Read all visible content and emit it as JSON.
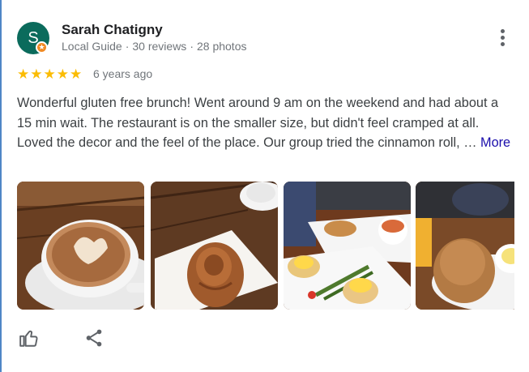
{
  "reviewer": {
    "initial": "S",
    "name": "Sarah Chatigny",
    "badge": "Local Guide",
    "reviews": "30 reviews",
    "photos": "28 photos"
  },
  "rating": {
    "stars": 5,
    "star_glyphs": "★★★★★",
    "time_ago": "6 years ago"
  },
  "review_text": "Wonderful gluten free brunch! Went around 9 am on the weekend and had about a 15 min wait. The restaurant is on the smaller size, but didn't feel cramped at all. Loved the decor and the feel of the place. Our group tried the cinnamon roll, …",
  "more_label": "More",
  "photos_list": [
    {
      "subject": "cappuccino-with-latte-art"
    },
    {
      "subject": "cinnamon-roll"
    },
    {
      "subject": "eggs-benedict-with-asparagus"
    },
    {
      "subject": "popover-with-butter"
    }
  ],
  "actions": {
    "like_icon": "thumb-up-icon",
    "share_icon": "share-icon"
  },
  "colors": {
    "avatar_bg": "#0b6b5c",
    "badge": "#f08a24",
    "star": "#fbbc04",
    "link": "#1a0dab",
    "secondary_text": "#70757a"
  }
}
